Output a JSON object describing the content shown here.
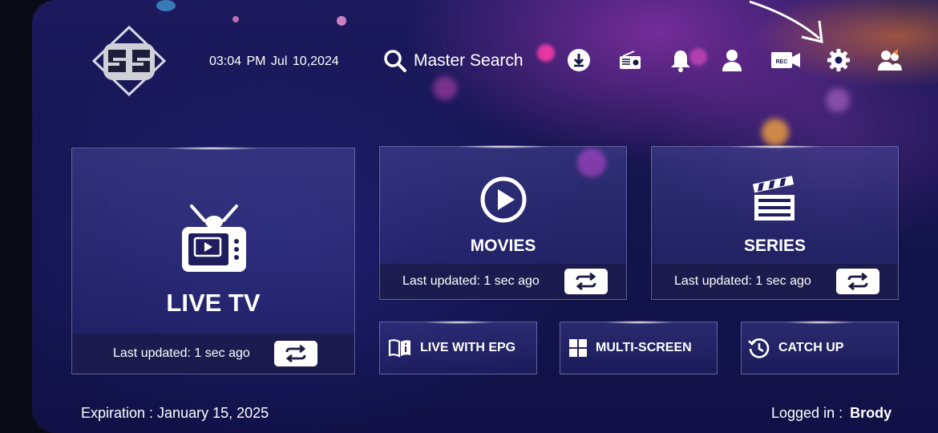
{
  "header": {
    "datetime": "03:04 PM  Jul 10,2024",
    "search_label": "Master Search",
    "icons": [
      "download-icon",
      "radio-icon",
      "bell-icon",
      "user-icon",
      "rec-icon",
      "gear-icon",
      "switch-user-icon"
    ],
    "rec_text": "REC"
  },
  "tiles": {
    "live_tv": {
      "title": "LIVE TV",
      "updated": "Last updated: 1 sec ago"
    },
    "movies": {
      "title": "MOVIES",
      "updated": "Last updated: 1 sec ago"
    },
    "series": {
      "title": "SERIES",
      "updated": "Last updated: 1 sec ago"
    }
  },
  "shortcuts": {
    "live_epg": "LIVE WITH EPG",
    "multi_screen": "MULTI-SCREEN",
    "catch_up": "CATCH UP"
  },
  "footer": {
    "expiration": "Expiration : January 15, 2025",
    "logged_in_label": "Logged in :",
    "username": "Brody"
  },
  "colors": {
    "background": "#14144d",
    "accent_pink": "#c83cc8",
    "accent_orange": "#ff8228"
  }
}
